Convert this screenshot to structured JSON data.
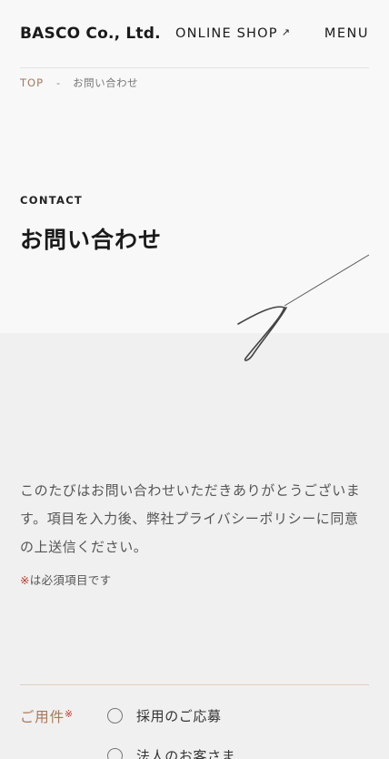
{
  "header": {
    "logo": "BASCO Co., Ltd.",
    "shop_link": "ONLINE SHOP",
    "shop_icon": "external-arrow-icon",
    "menu": "MENU"
  },
  "breadcrumb": {
    "top": "TOP",
    "separator": "-",
    "current": "お問い合わせ"
  },
  "hero": {
    "eyebrow": "CONTACT",
    "title": "お問い合わせ"
  },
  "intro": {
    "text": "このたびはお問い合わせいただきありがとうございます。項目を入力後、弊社プライバシーポリシーに同意の上送信ください。",
    "required_mark": "※",
    "required_note": "は必須項目です"
  },
  "form": {
    "field_label": "ご用件",
    "required_mark": "※",
    "options": [
      "採用のご応募",
      "法人のお客さま"
    ]
  },
  "colors": {
    "accent": "#a8785a",
    "required": "#c0392b"
  }
}
